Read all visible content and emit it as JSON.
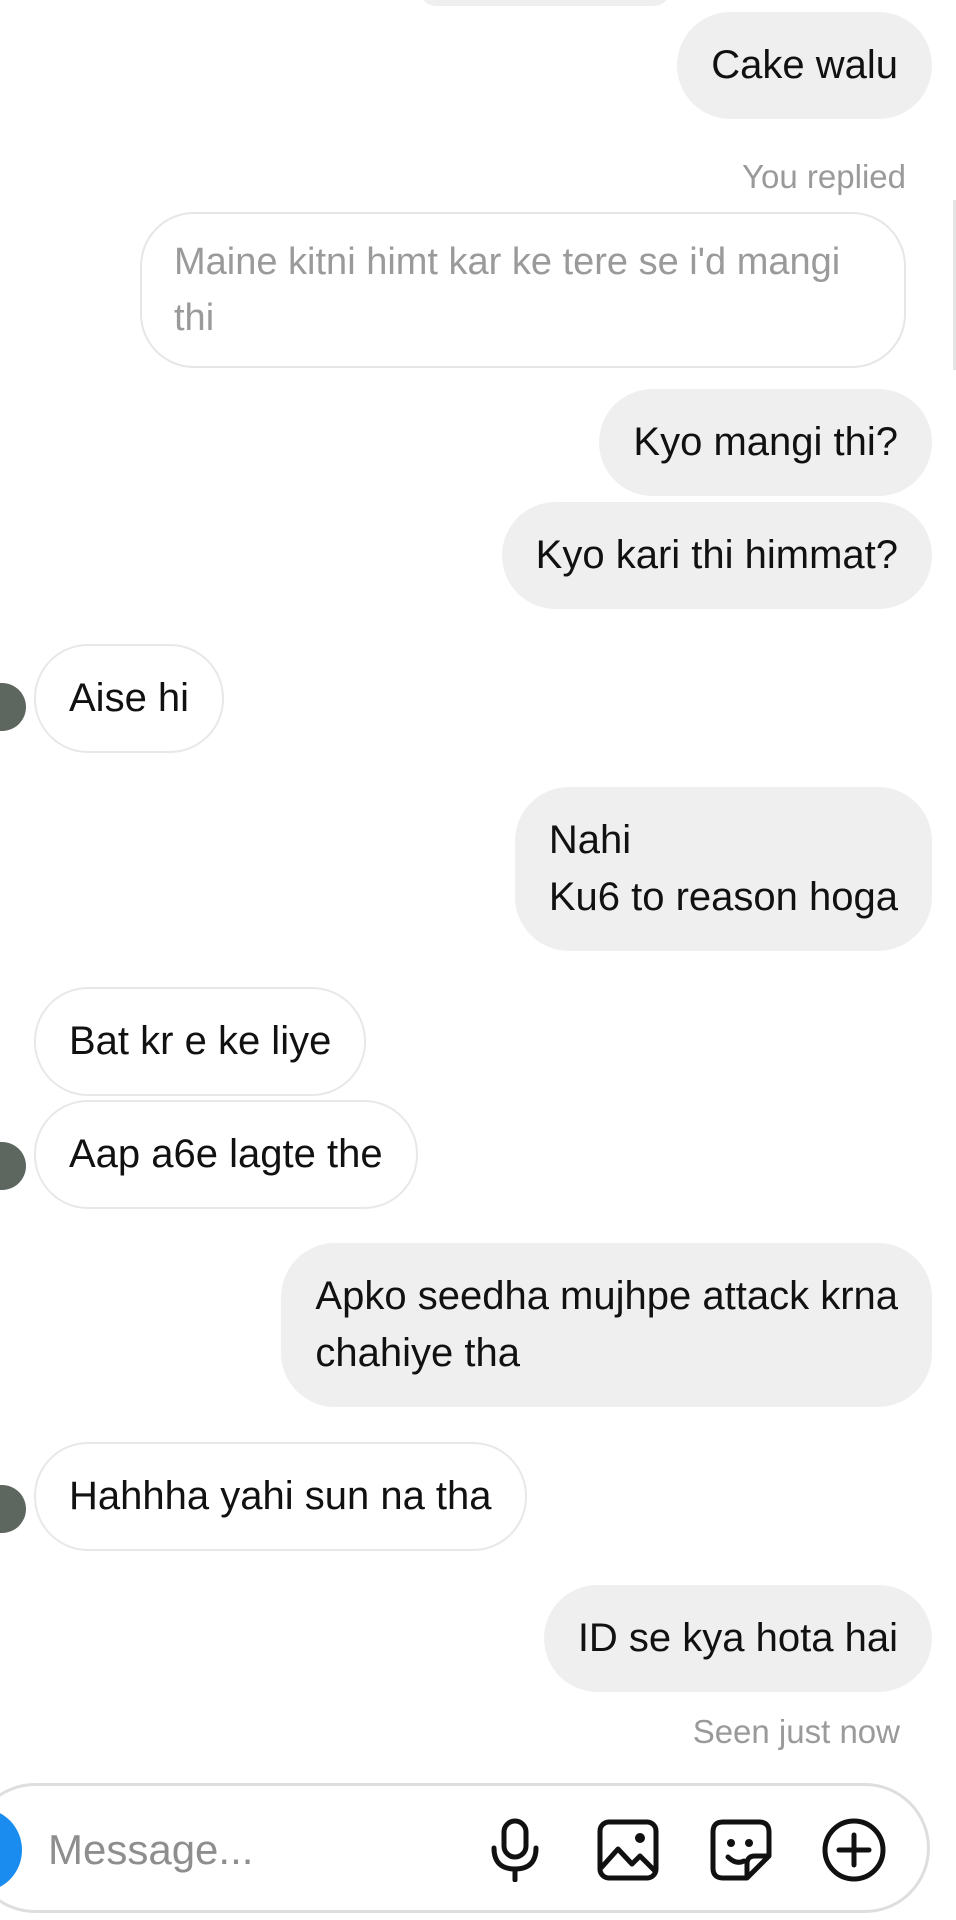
{
  "thread": {
    "messages": [
      {
        "text": "Cake walu"
      },
      {
        "text": "Kyo mangi thi?"
      },
      {
        "text": "Kyo kari thi himmat?"
      },
      {
        "text": "Aise hi"
      },
      {
        "text": "Nahi\nKu6 to reason hoga"
      },
      {
        "text": "Bat kr e ke liye"
      },
      {
        "text": "Aap a6e lagte the"
      },
      {
        "text": "Apko seedha mujhpe attack krna\nchahiye tha"
      },
      {
        "text": "Hahhha yahi sun na tha"
      },
      {
        "text": "ID se kya hota hai"
      }
    ],
    "reply_label": "You replied",
    "quoted_text": "Maine kitni himt kar ke tere se i'd mangi\nthi",
    "seen_status": "Seen just now"
  },
  "composer": {
    "placeholder": "Message...",
    "icons": [
      "camera-icon",
      "microphone-icon",
      "gallery-icon",
      "sticker-icon",
      "add-icon"
    ]
  },
  "colors": {
    "outgoing_bubble": "#efefef",
    "incoming_border": "#e8e8e8",
    "meta_text": "#9a9a9a",
    "camera_button": "#1a8cf0"
  }
}
